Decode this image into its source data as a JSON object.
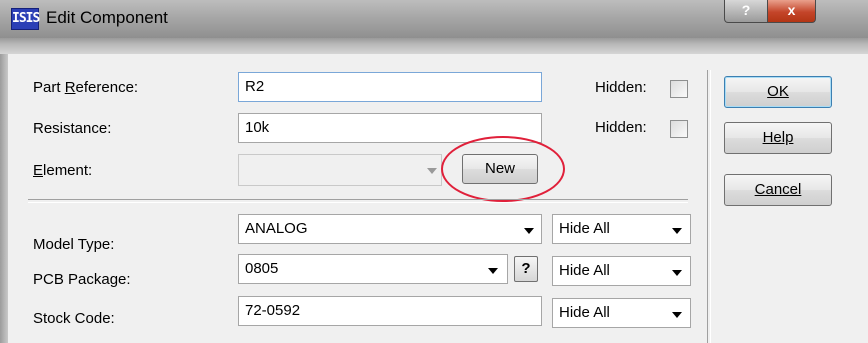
{
  "window": {
    "app_icon_text": "ISIS",
    "title": "Edit Component",
    "help_caption": "?",
    "close_caption": "x"
  },
  "fields": {
    "part_reference": {
      "label": "Part Reference:",
      "underline_char": "R",
      "value": "R2",
      "hidden_label": "Hidden:"
    },
    "resistance": {
      "label": "Resistance:",
      "value": "10k",
      "hidden_label": "Hidden:"
    },
    "element": {
      "label": "Element:",
      "underline_char": "E",
      "value": "",
      "new_button": "New"
    },
    "model_type": {
      "label": "Model Type:",
      "value": "ANALOG",
      "hide_option": "Hide All"
    },
    "pcb_package": {
      "label": "PCB Package:",
      "value": "0805",
      "help_button": "?",
      "hide_option": "Hide All"
    },
    "stock_code": {
      "label": "Stock Code:",
      "value": "72-0592",
      "hide_option": "Hide All"
    }
  },
  "buttons": {
    "ok": "OK",
    "help": "Help",
    "cancel": "Cancel"
  },
  "colors": {
    "highlight_circle": "#e0203a",
    "default_button_border": "#3c7fb1"
  }
}
